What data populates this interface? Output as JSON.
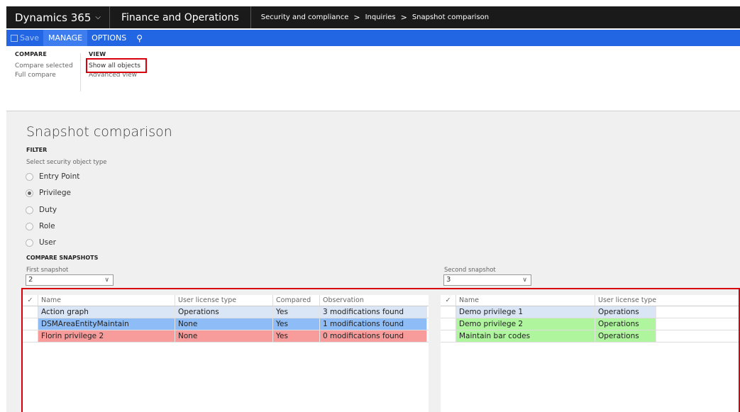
{
  "topnav": {
    "app": "Dynamics 365",
    "module": "Finance and Operations",
    "breadcrumb": [
      "Security and compliance",
      "Inquiries",
      "Snapshot comparison"
    ]
  },
  "actionbar": {
    "save": "Save",
    "manage": "MANAGE",
    "options": "OPTIONS"
  },
  "ribbon": {
    "compare": {
      "title": "COMPARE",
      "items": [
        "Compare selected",
        "Full compare"
      ]
    },
    "view": {
      "title": "VIEW",
      "items": [
        "Show all objects",
        "Advanced view"
      ]
    }
  },
  "page": {
    "title": "Snapshot comparison",
    "filter_label": "FILTER",
    "select_type_label": "Select security object type",
    "radio_options": [
      "Entry Point",
      "Privilege",
      "Duty",
      "Role",
      "User"
    ],
    "selected_option": "Privilege",
    "compare_label": "COMPARE SNAPSHOTS",
    "first_snapshot_label": "First snapshot",
    "first_snapshot_value": "2",
    "second_snapshot_label": "Second snapshot",
    "second_snapshot_value": "3"
  },
  "grid_left": {
    "columns": [
      "Name",
      "User license type",
      "Compared",
      "Observation"
    ],
    "rows": [
      [
        "Action graph",
        "Operations",
        "Yes",
        "3 modifications found"
      ],
      [
        "DSMAreaEntityMaintain",
        "None",
        "Yes",
        "1 modifications found"
      ],
      [
        "Florin privilege 2",
        "None",
        "Yes",
        "0 modifications found"
      ]
    ]
  },
  "grid_right": {
    "columns": [
      "Name",
      "User license type"
    ],
    "rows": [
      [
        "Demo privilege 1",
        "Operations"
      ],
      [
        "Demo privilege 2",
        "Operations"
      ],
      [
        "Maintain bar codes",
        "Operations"
      ]
    ]
  },
  "colors": {
    "nav": "#1a1a1a",
    "actionbar": "#2266e3",
    "highlight": "#d8000c",
    "row_selected": "#dae6f5",
    "row_blue": "#8dbcf7",
    "row_red": "#f79b9b",
    "row_green": "#aef59e"
  }
}
